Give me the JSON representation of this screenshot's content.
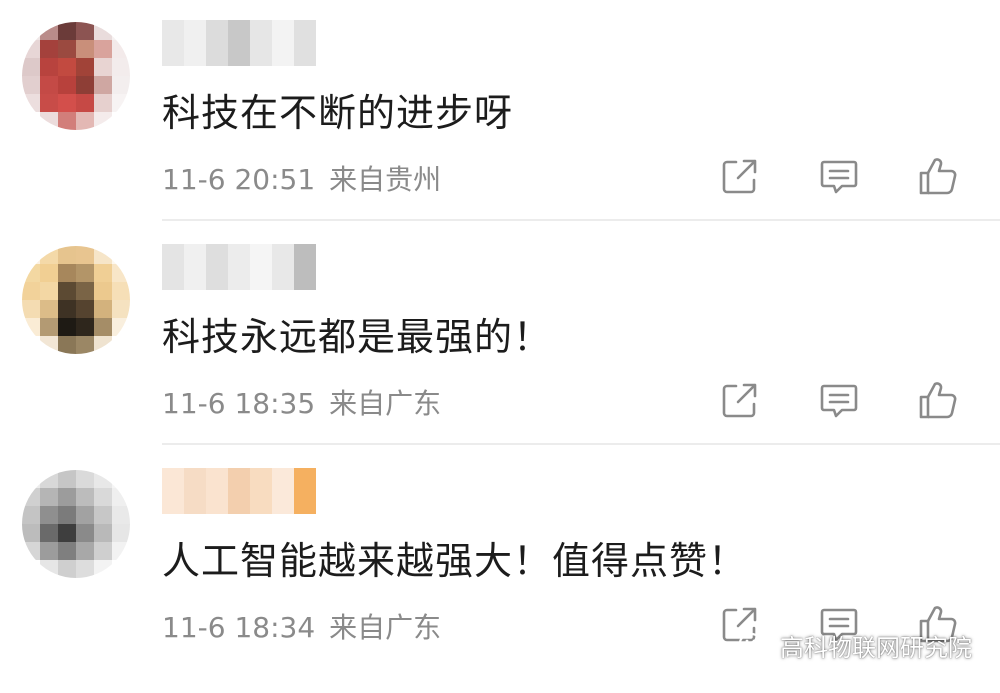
{
  "comments": [
    {
      "username": "",
      "text": "科技在不断的进步呀",
      "time": "11-6 20:51",
      "location": "来自贵州",
      "avatar_colors": [
        "#efe6e6",
        "#ba8c8a",
        "#6b3b39",
        "#8c5452",
        "#e9dcdc",
        "#f6f1f1",
        "#e7d6d6",
        "#a4413c",
        "#9b4a40",
        "#c98f7a",
        "#d9a39c",
        "#f3eaea",
        "#ddc9c9",
        "#b8433e",
        "#c24a40",
        "#a14338",
        "#e8d4d2",
        "#f3ecec",
        "#e2cfcf",
        "#c44a46",
        "#b8413c",
        "#8e3e36",
        "#cfa7a2",
        "#f3eeee",
        "#ecdede",
        "#c84c48",
        "#d34f4b",
        "#c64945",
        "#e6d0ce",
        "#f7f3f3",
        "#ffffff",
        "#ecdcdc",
        "#d27e7a",
        "#e3b8b4",
        "#f4ebeb",
        "#ffffff"
      ],
      "username_colors": [
        "#e8e8e8",
        "#f0f0f0",
        "#dcdcdc",
        "#c8c8c8",
        "#e6e6e6",
        "#f3f3f3",
        "#e0e0e0"
      ]
    },
    {
      "username": "",
      "text": "科技永远都是最强的！",
      "time": "11-6 18:35",
      "location": "来自广东",
      "avatar_colors": [
        "#fbf1e2",
        "#f4d9a8",
        "#e6c48e",
        "#e8c590",
        "#f6e5c8",
        "#fdf8ef",
        "#f3d8a2",
        "#f1cf93",
        "#a7875c",
        "#b39568",
        "#f0cf95",
        "#f8e6c8",
        "#f2d29a",
        "#f3d7a4",
        "#5c4a33",
        "#7a6446",
        "#ecc98e",
        "#f6dfb7",
        "#f4dcb2",
        "#dcbc88",
        "#3e3224",
        "#55432f",
        "#d3b27d",
        "#f5e2c0",
        "#faecd5",
        "#b39a73",
        "#1e1a14",
        "#2e261c",
        "#a58d67",
        "#f9efde",
        "#ffffff",
        "#f2e6d5",
        "#8a7757",
        "#9b8765",
        "#efe3d0",
        "#ffffff"
      ],
      "username_colors": [
        "#e4e4e4",
        "#f0f0f0",
        "#dedede",
        "#ececec",
        "#f5f5f5",
        "#e8e8e8",
        "#bdbdbd"
      ]
    },
    {
      "username": "",
      "text": "人工智能越来越强大！值得点赞！",
      "time": "11-6 18:34",
      "location": "来自广东",
      "avatar_colors": [
        "#ececec",
        "#d8d8d8",
        "#c6c6c6",
        "#dadada",
        "#e8e8e8",
        "#f5f5f5",
        "#d0d0d0",
        "#b5b5b5",
        "#9c9c9c",
        "#bcbcbc",
        "#d9d9d9",
        "#efefef",
        "#c4c4c4",
        "#8f8f8f",
        "#7b7b7b",
        "#a2a2a2",
        "#c7c7c7",
        "#e9e9e9",
        "#bcbcbc",
        "#6a6a6a",
        "#3e3e3e",
        "#8a8a8a",
        "#b9b9b9",
        "#e6e6e6",
        "#d6d6d6",
        "#9c9c9c",
        "#7f7f7f",
        "#a8a8a8",
        "#cfcfcf",
        "#f2f2f2",
        "#ffffff",
        "#e6e6e6",
        "#cfcfcf",
        "#dddddd",
        "#f3f3f3",
        "#ffffff"
      ],
      "username_colors": [
        "#fbe7d6",
        "#f6dcc5",
        "#fae3cf",
        "#f3cfae",
        "#f8dcc0",
        "#fbe9da",
        "#f5b060"
      ]
    }
  ],
  "icons": {
    "share": "share-icon",
    "reply": "reply-icon",
    "like": "thumbs-up-icon",
    "watermark": "wechat-icon"
  },
  "watermark": {
    "text": "高科物联网研究院"
  }
}
